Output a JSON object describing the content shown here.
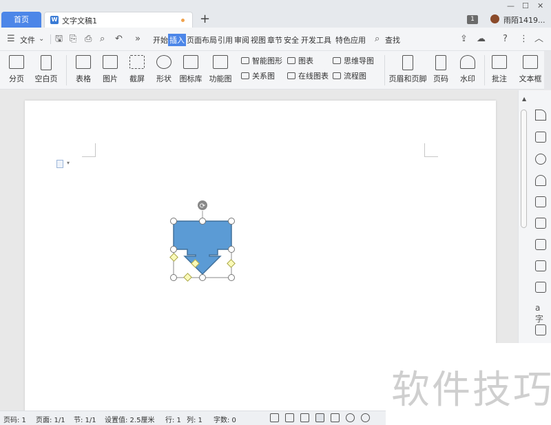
{
  "tabs": {
    "home": "首页",
    "doc": "文字文稿1",
    "new_tab": "+"
  },
  "window": {
    "badge": "1",
    "user": "雨陌1419..."
  },
  "menu": {
    "file": "文件",
    "items": [
      "开始",
      "插入",
      "页面布局",
      "引用",
      "审阅",
      "视图",
      "章节",
      "安全",
      "开发工具",
      "特色应用"
    ],
    "active": "插入",
    "search": "查找"
  },
  "ribbon": {
    "page_break": "分页",
    "blank_page": "空白页",
    "table": "表格",
    "picture": "图片",
    "screenshot": "截屏",
    "shape": "形状",
    "icon_lib": "图标库",
    "func_chart": "功能图",
    "smart_art": "智能图形",
    "chart": "图表",
    "mind_map": "思维导图",
    "relation": "关系图",
    "online_chart": "在线图表",
    "flowchart": "流程图",
    "header_footer": "页眉和页脚",
    "page_num": "页码",
    "watermark": "水印",
    "comment": "批注",
    "textbox": "文本框"
  },
  "status": {
    "page_num": "页码: 1",
    "pages": "页面: 1/1",
    "section": "节: 1/1",
    "setting": "设置值: 2.5厘米",
    "row": "行: 1",
    "col": "列: 1",
    "words": "字数: 0"
  },
  "watermark_text": "软件技巧",
  "colors": {
    "accent": "#4c86e8",
    "shape_fill": "#5b9bd5",
    "shape_stroke": "#41719c"
  }
}
